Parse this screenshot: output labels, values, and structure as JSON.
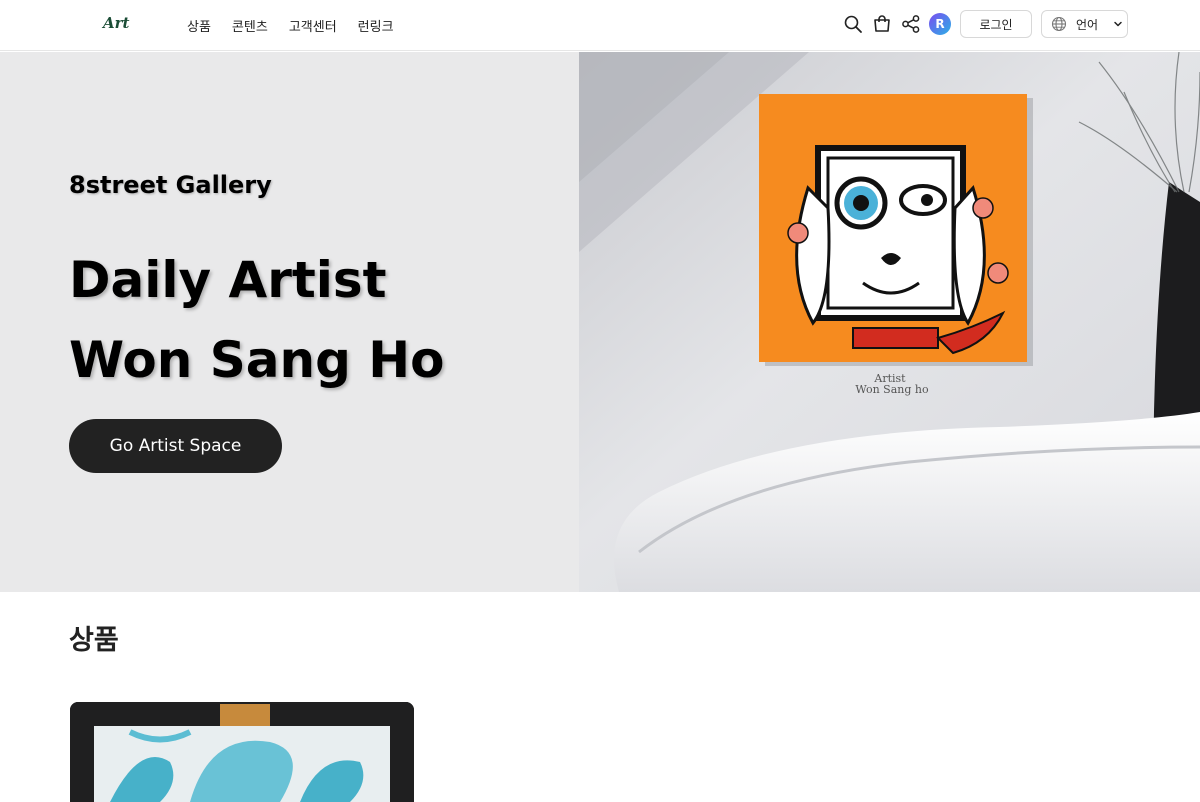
{
  "header": {
    "logo": "Art",
    "nav": [
      "상품",
      "콘텐츠",
      "고객센터",
      "런링크"
    ],
    "icons": [
      "search-icon",
      "cart-icon",
      "share-icon"
    ],
    "avatar_letter": "R",
    "login_label": "로그인",
    "language_label": "언어"
  },
  "hero": {
    "gallery_name": "8street Gallery",
    "title_line1": "Daily Artist",
    "title_line2": "Won Sang Ho",
    "cta_label": "Go Artist Space",
    "painting_caption_line1": "Artist",
    "painting_caption_line2": "Won Sang ho"
  },
  "products": {
    "section_title": "상품"
  },
  "colors": {
    "hero_bg": "#e9e9ea",
    "cta_bg": "#222222",
    "painting_orange": "#f68b1f",
    "logo_green": "#1b4d36"
  }
}
